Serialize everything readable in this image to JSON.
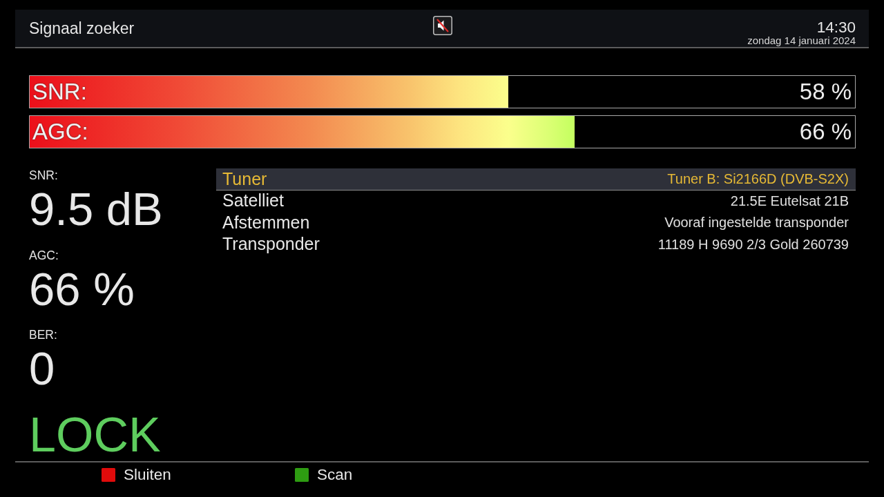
{
  "header": {
    "title": "Signaal zoeker",
    "muted": true,
    "time": "14:30",
    "date": "zondag 14 januari 2024"
  },
  "bars": [
    {
      "label": "SNR:",
      "level": 0.58,
      "reading": "58 %"
    },
    {
      "label": "AGC:",
      "level": 0.66,
      "reading": "66 %"
    }
  ],
  "readings": [
    {
      "label": "SNR:",
      "value": "9.5 dB"
    },
    {
      "label": "AGC:",
      "value": "66 %"
    },
    {
      "label": "BER:",
      "value": "0"
    }
  ],
  "lock_status": {
    "text": "LOCK",
    "locked": true
  },
  "info_rows": [
    {
      "label": "Tuner",
      "value": "Tuner B: Si2166D (DVB-S2X)",
      "selected": true
    },
    {
      "label": "Satelliet",
      "value": "21.5E Eutelsat 21B",
      "selected": false
    },
    {
      "label": "Afstemmen",
      "value": "Vooraf ingestelde transponder",
      "selected": false
    },
    {
      "label": "Transponder",
      "value": "11189 H 9690 2/3 Gold 260739",
      "selected": false
    }
  ],
  "color_buttons": [
    {
      "label": "Sluiten",
      "color": "#e00b0b"
    },
    {
      "label": "Scan",
      "color": "#2e9c12"
    }
  ]
}
